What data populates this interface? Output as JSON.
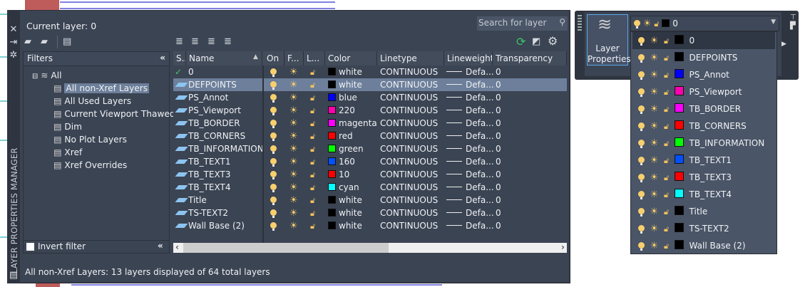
{
  "panel": {
    "vertical_title": "LAYER PROPERTIES MANAGER",
    "current_layer": "Current layer: 0",
    "search_placeholder": "Search for layer",
    "status": "All non-Xref Layers: 13 layers displayed of 64 total layers"
  },
  "filters": {
    "header": "Filters",
    "invert_label": "Invert filter",
    "tree": [
      {
        "label": "All",
        "level": 0
      },
      {
        "label": "All non-Xref Layers",
        "level": 1,
        "selected": true
      },
      {
        "label": "All Used Layers",
        "level": 1
      },
      {
        "label": "Current Viewport Thawed",
        "level": 1
      },
      {
        "label": "Dim",
        "level": 1
      },
      {
        "label": "No Plot Layers",
        "level": 1
      },
      {
        "label": "Xref",
        "level": 1
      },
      {
        "label": "Xref Overrides",
        "level": 1
      }
    ]
  },
  "grid": {
    "headers": [
      "S..",
      "Name",
      "On",
      "F...",
      "L...",
      "Color",
      "Linetype",
      "Lineweight",
      "Transparency"
    ],
    "rows": [
      {
        "name": "0",
        "color": "white",
        "hex": "#000000",
        "linetype": "CONTINUOUS",
        "lineweight": "Defa...",
        "transparency": "0",
        "current": true
      },
      {
        "name": "DEFPOINTS",
        "color": "white",
        "hex": "#000000",
        "linetype": "CONTINUOUS",
        "lineweight": "Defa...",
        "transparency": "0",
        "selected": true
      },
      {
        "name": "PS_Annot",
        "color": "blue",
        "hex": "#0000ff",
        "linetype": "CONTINUOUS",
        "lineweight": "Defa...",
        "transparency": "0"
      },
      {
        "name": "PS_Viewport",
        "color": "220",
        "hex": "#ff00b0",
        "linetype": "CONTINUOUS",
        "lineweight": "Defa...",
        "transparency": "0"
      },
      {
        "name": "TB_BORDER",
        "color": "magenta",
        "hex": "#ff00ff",
        "linetype": "CONTINUOUS",
        "lineweight": "Defa...",
        "transparency": "0"
      },
      {
        "name": "TB_CORNERS",
        "color": "red",
        "hex": "#ff0000",
        "linetype": "CONTINUOUS",
        "lineweight": "Defa...",
        "transparency": "0"
      },
      {
        "name": "TB_INFORMATION",
        "color": "green",
        "hex": "#00ff00",
        "linetype": "CONTINUOUS",
        "lineweight": "Defa...",
        "transparency": "0"
      },
      {
        "name": "TB_TEXT1",
        "color": "160",
        "hex": "#0050ff",
        "linetype": "CONTINUOUS",
        "lineweight": "Defa...",
        "transparency": "0"
      },
      {
        "name": "TB_TEXT3",
        "color": "10",
        "hex": "#ff0000",
        "linetype": "CONTINUOUS",
        "lineweight": "Defa...",
        "transparency": "0"
      },
      {
        "name": "TB_TEXT4",
        "color": "cyan",
        "hex": "#00ffff",
        "linetype": "CONTINUOUS",
        "lineweight": "Defa...",
        "transparency": "0"
      },
      {
        "name": "Title",
        "color": "white",
        "hex": "#000000",
        "linetype": "CONTINUOUS",
        "lineweight": "Defa...",
        "transparency": "0"
      },
      {
        "name": "TS-TEXT2",
        "color": "white",
        "hex": "#000000",
        "linetype": "CONTINUOUS",
        "lineweight": "Defa...",
        "transparency": "0"
      },
      {
        "name": "Wall Base (2)",
        "color": "white",
        "hex": "#000000",
        "linetype": "CONTINUOUS",
        "lineweight": "Defa...",
        "transparency": "0"
      }
    ],
    "scroll_fraction": 0.55
  },
  "ribbon": {
    "button_label_1": "Layer",
    "button_label_2": "Properties",
    "dropdown_value": "0"
  }
}
